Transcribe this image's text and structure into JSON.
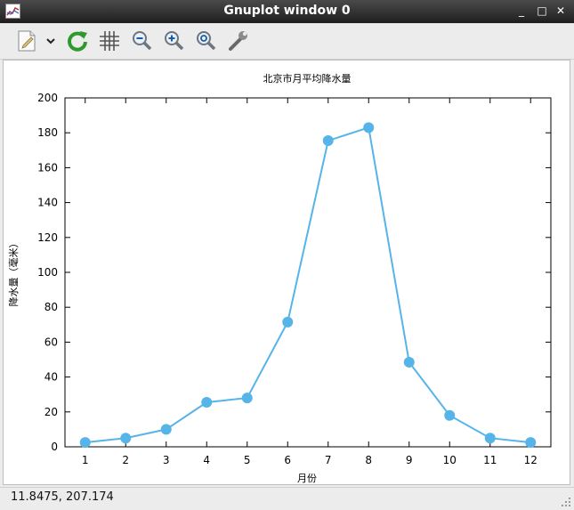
{
  "window": {
    "title": "Gnuplot window 0"
  },
  "window_controls": {
    "minimize": "_",
    "maximize": "□",
    "close": "✕"
  },
  "toolbar": {
    "buttons": [
      {
        "name": "export-button",
        "icon": "document-export-icon"
      },
      {
        "name": "export-menu-button",
        "icon": "chevron-down-icon"
      },
      {
        "name": "replot-button",
        "icon": "refresh-icon"
      },
      {
        "name": "grid-button",
        "icon": "grid-icon"
      },
      {
        "name": "zoom-previous-button",
        "icon": "zoom-out-icon"
      },
      {
        "name": "zoom-next-button",
        "icon": "zoom-in-icon"
      },
      {
        "name": "autoscale-button",
        "icon": "zoom-fit-icon"
      },
      {
        "name": "settings-button",
        "icon": "wrench-icon"
      }
    ]
  },
  "status": {
    "coords": "11.8475,  207.174"
  },
  "chart_data": {
    "type": "line",
    "title": "北京市月平均降水量",
    "xlabel": "月份",
    "ylabel": "降水量（毫米）",
    "x": [
      1,
      2,
      3,
      4,
      5,
      6,
      7,
      8,
      9,
      10,
      11,
      12
    ],
    "series": [
      {
        "values": [
          2.5,
          5,
          10,
          25.5,
          28,
          71.5,
          175.5,
          183,
          48.5,
          18,
          5,
          2.5
        ]
      }
    ],
    "xlim": [
      0.5,
      12.5
    ],
    "ylim": [
      0,
      200
    ],
    "xticks": [
      1,
      2,
      3,
      4,
      5,
      6,
      7,
      8,
      9,
      10,
      11,
      12
    ],
    "yticks": [
      0,
      20,
      40,
      60,
      80,
      100,
      120,
      140,
      160,
      180,
      200
    ],
    "color": "#56b4e9",
    "grid": false,
    "markers": true
  }
}
